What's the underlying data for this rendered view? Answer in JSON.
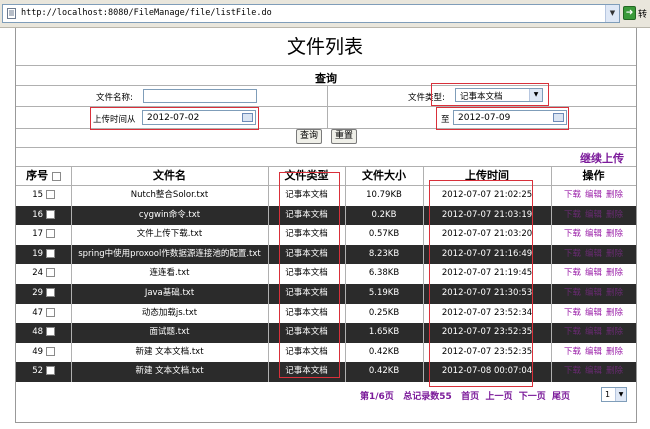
{
  "browser": {
    "url": "http://localhost:8080/FileManage/file/listFile.do",
    "go_label": "转"
  },
  "page": {
    "title": "文件列表"
  },
  "search": {
    "heading": "查询",
    "filename_label": "文件名称:",
    "filename_value": "",
    "filetype_label": "文件类型:",
    "filetype_selected": "记事本文档",
    "upload_from_label": "上传时间从",
    "date_from": "2012-07-02",
    "to_label": "至",
    "date_to": "2012-07-09",
    "query_button": "查询",
    "reset_button": "重置"
  },
  "continue_upload": "继续上传",
  "table": {
    "headers": {
      "index": "序号",
      "name": "文件名",
      "type": "文件类型",
      "size": "文件大小",
      "time": "上传时间",
      "ops": "操作"
    },
    "rows": [
      {
        "no": "15",
        "name": "Nutch整合Solor.txt",
        "type": "记事本文档",
        "size": "10.79KB",
        "time": "2012-07-07 21:02:25"
      },
      {
        "no": "16",
        "name": "cygwin命令.txt",
        "type": "记事本文档",
        "size": "0.2KB",
        "time": "2012-07-07 21:03:19"
      },
      {
        "no": "17",
        "name": "文件上传下载.txt",
        "type": "记事本文档",
        "size": "0.57KB",
        "time": "2012-07-07 21:03:20"
      },
      {
        "no": "19",
        "name": "spring中使用proxool作数据源连接池的配置.txt",
        "type": "记事本文档",
        "size": "8.23KB",
        "time": "2012-07-07 21:16:49"
      },
      {
        "no": "24",
        "name": "连连看.txt",
        "type": "记事本文档",
        "size": "6.38KB",
        "time": "2012-07-07 21:19:45"
      },
      {
        "no": "29",
        "name": "Java基础.txt",
        "type": "记事本文档",
        "size": "5.19KB",
        "time": "2012-07-07 21:30:53"
      },
      {
        "no": "47",
        "name": "动态加载js.txt",
        "type": "记事本文档",
        "size": "0.25KB",
        "time": "2012-07-07 23:52:34"
      },
      {
        "no": "48",
        "name": "面试题.txt",
        "type": "记事本文档",
        "size": "1.65KB",
        "time": "2012-07-07 23:52:35"
      },
      {
        "no": "49",
        "name": "新建 文本文档.txt",
        "type": "记事本文档",
        "size": "0.42KB",
        "time": "2012-07-07 23:52:35"
      },
      {
        "no": "52",
        "name": "新建 文本文档.txt",
        "type": "记事本文档",
        "size": "0.42KB",
        "time": "2012-07-08 00:07:04"
      }
    ],
    "actions": {
      "download": "下载",
      "edit": "编辑",
      "delete": "删除"
    }
  },
  "pager": {
    "page_info": "第1/6页",
    "total": "总记录数55",
    "first": "首页",
    "prev": "上一页",
    "next": "下一页",
    "last": "尾页",
    "selected_page": "1"
  },
  "colors": {
    "accent": "#7b1a9a",
    "highlight_box": "#d9303a",
    "dark_row": "#2b2b2b"
  }
}
